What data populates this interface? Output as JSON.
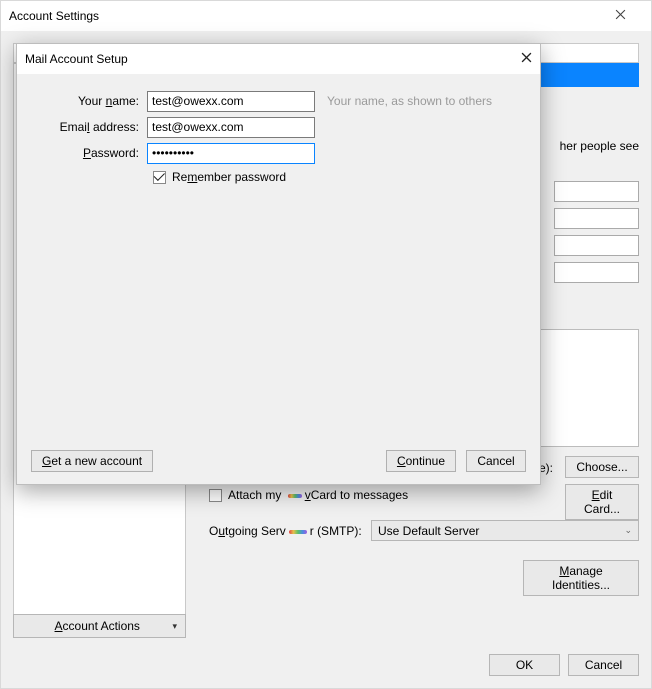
{
  "window": {
    "title": "Account Settings"
  },
  "background": {
    "partial_text_other_people": "her people see",
    "partial_text_age": "age):",
    "choose_label": "Choose...",
    "edit_card_label": "Edit Card...",
    "attach_vcard_pre": "Attach my ",
    "attach_vcard_post": "Card to messages",
    "outgoing_pre": "Outgoing Serv",
    "outgoing_post": "r (SMTP):",
    "smtp_value": "Use Default Server",
    "manage_identities": "Manage Identities...",
    "account_actions": "Account Actions",
    "ok_label": "OK",
    "cancel_label": "Cancel"
  },
  "modal": {
    "title": "Mail Account Setup",
    "your_name_label": "Your name:",
    "email_label": "Email address:",
    "password_label": "Password:",
    "name_value": "test@owexx.com",
    "email_value": "test@owexx.com",
    "password_value": "••••••••••",
    "name_hint": "Your name, as shown to others",
    "remember_label": "Remember password",
    "get_new_account": "Get a new account",
    "continue": "Continue",
    "cancel": "Cancel"
  }
}
